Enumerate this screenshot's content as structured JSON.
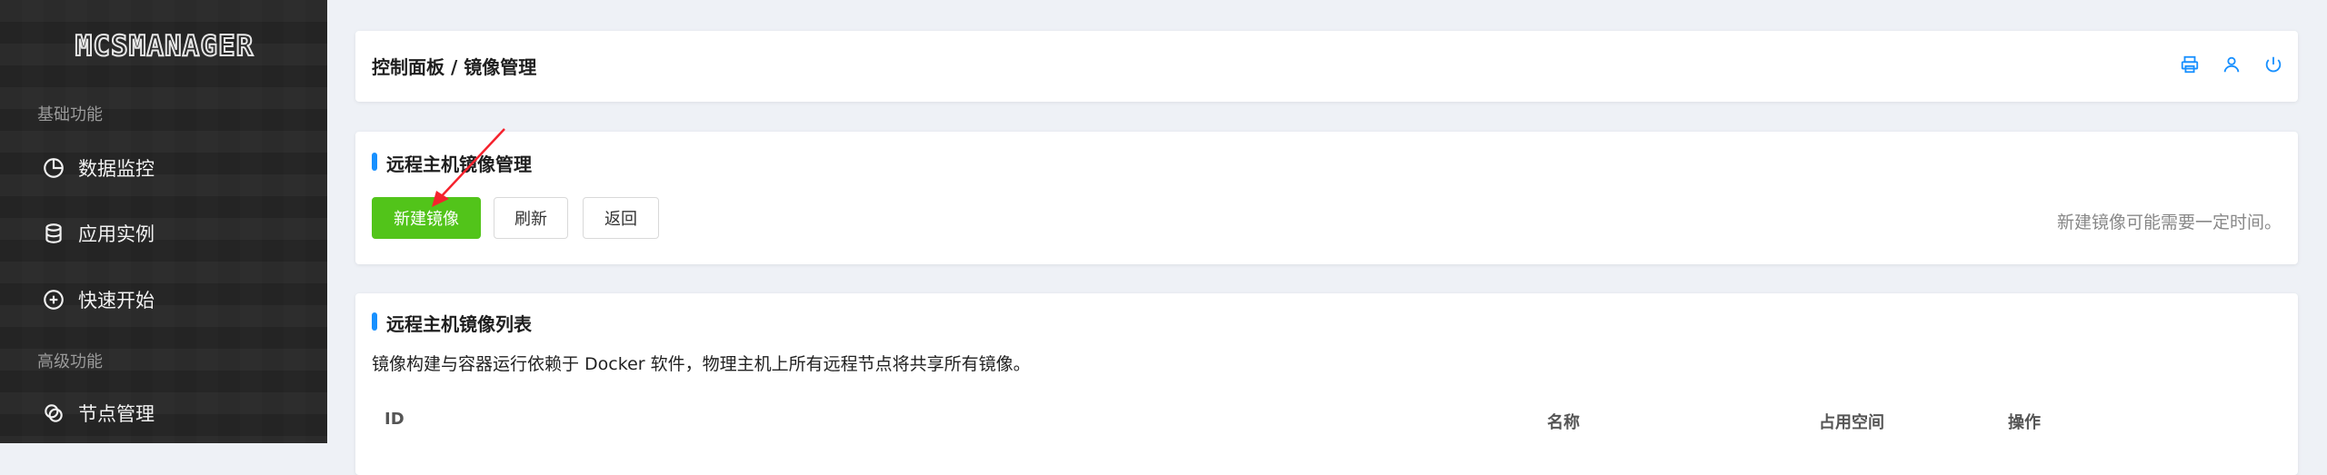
{
  "sidebar": {
    "logo": "MCSMANAGER",
    "groups": [
      {
        "label": "基础功能"
      },
      {
        "label": "高级功能"
      }
    ],
    "items": [
      {
        "label": "数据监控",
        "icon": "pie-chart-icon"
      },
      {
        "label": "应用实例",
        "icon": "database-icon"
      },
      {
        "label": "快速开始",
        "icon": "plus-circle-icon"
      },
      {
        "label": "节点管理",
        "icon": "cluster-icon"
      }
    ]
  },
  "header": {
    "breadcrumb": "控制面板 / 镜像管理",
    "tools": [
      "printer-icon",
      "user-icon",
      "power-icon"
    ]
  },
  "manage": {
    "title": "远程主机镜像管理",
    "buttons": {
      "create": "新建镜像",
      "refresh": "刷新",
      "back": "返回"
    },
    "hint": "新建镜像可能需要一定时间。"
  },
  "list": {
    "title": "远程主机镜像列表",
    "description": "镜像构建与容器运行依赖于 Docker 软件，物理主机上所有远程节点将共享所有镜像。",
    "columns": [
      "ID",
      "名称",
      "占用空间",
      "操作"
    ]
  },
  "colors": {
    "accent": "#1890ff",
    "success": "#52c41a",
    "sidebar": "#262626"
  }
}
